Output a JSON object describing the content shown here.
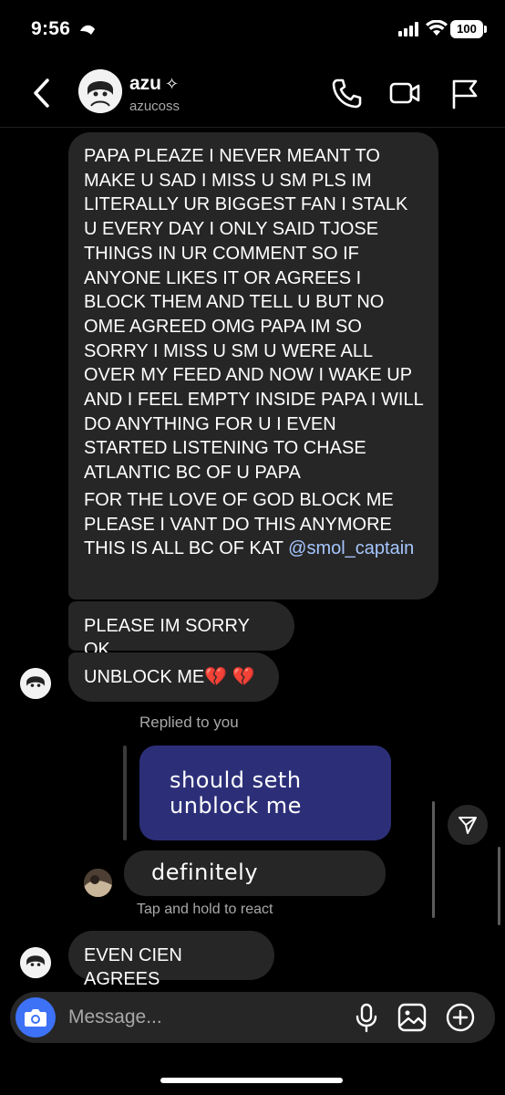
{
  "status_bar": {
    "time": "9:56",
    "battery": "100"
  },
  "header": {
    "name": "azu",
    "name_badge": "✧",
    "handle": "azucoss"
  },
  "messages": {
    "long_message_p1": "PAPA PLEAZE I NEVER MEANT TO MAKE U SAD I MISS U SM PLS IM LITERALLY UR BIGGEST FAN I STALK U EVERY DAY I ONLY SAID TJOSE THINGS IN UR COMMENT SO IF ANYONE LIKES IT OR AGREES I BLOCK THEM AND TELL U BUT NO OME AGREED OMG PAPA IM SO SORRY I MISS U SM U WERE ALL OVER MY FEED AND NOW I WAKE UP AND I FEEL EMPTY INSIDE PAPA I WILL DO ANYTHING FOR U I EVEN STARTED LISTENING TO CHASE ATLANTIC BC OF U PAPA",
    "long_message_p2": "FOR THE LOVE OF GOD BLOCK ME PLEASE I VANT DO THIS ANYMORE THIS IS ALL BC OF KAT",
    "mention": "@smol_captain",
    "msg_sorry": "PLEASE IM SORRY OK",
    "msg_unblock": "UNBLOCK ME💔 💔",
    "replied_label": "Replied to you",
    "quoted_message": "should seth unblock me",
    "reply_message": "definitely",
    "tap_hold": "Tap and hold to react",
    "msg_agrees": "EVEN CIEN AGREES"
  },
  "composer": {
    "placeholder": "Message..."
  },
  "colors": {
    "background": "#000000",
    "bubble": "#262626",
    "quoted_bubble": "#2c2f78",
    "camera_button": "#3d72f6",
    "mention": "#a6c6ff",
    "secondary_text": "#a8a8a8"
  },
  "icons": [
    "back-chevron-icon",
    "verified-sparkle-icon",
    "phone-icon",
    "video-camera-icon",
    "flag-icon",
    "share-icon",
    "camera-icon",
    "microphone-icon",
    "gallery-icon",
    "plus-icon"
  ]
}
